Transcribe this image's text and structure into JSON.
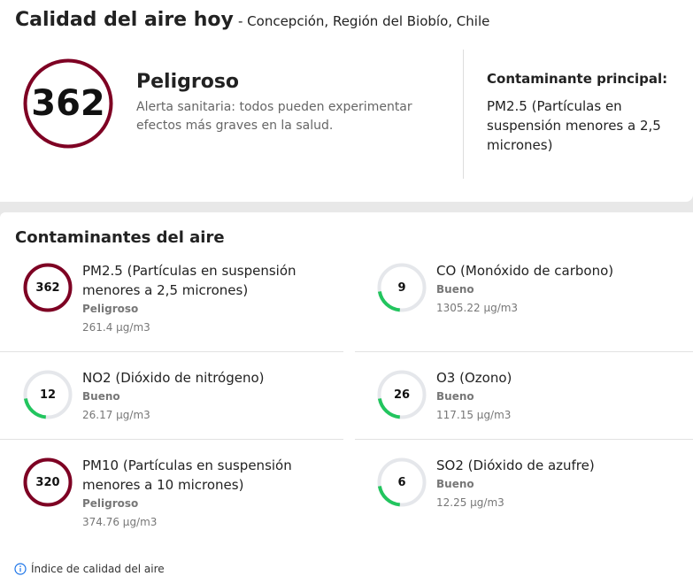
{
  "header": {
    "title": "Calidad del aire hoy",
    "location": "- Concepción, Región del Biobío, Chile"
  },
  "summary": {
    "aqi": "362",
    "level": "Peligroso",
    "description": "Alerta sanitaria: todos pueden experimentar efectos más graves en la salud.",
    "main_pollutant_label": "Contaminante principal:",
    "main_pollutant_value": "PM2.5 (Partículas en suspensión menores a 2,5 micrones)"
  },
  "pollutants_section": {
    "title": "Contaminantes del aire",
    "items": [
      {
        "name": "PM2.5 (Partículas en suspensión menores a 2,5 micrones)",
        "value": "362",
        "level": "Peligroso",
        "concentration": "261.4 µg/m3",
        "color": "#7e0023",
        "fill": 1.0
      },
      {
        "name": "CO (Monóxido de carbono)",
        "value": "9",
        "level": "Bueno",
        "concentration": "1305.22 µg/m3",
        "color": "#22c55e",
        "fill": 0.18
      },
      {
        "name": "NO2 (Dióxido de nitrógeno)",
        "value": "12",
        "level": "Bueno",
        "concentration": "26.17 µg/m3",
        "color": "#22c55e",
        "fill": 0.18
      },
      {
        "name": "O3 (Ozono)",
        "value": "26",
        "level": "Bueno",
        "concentration": "117.15 µg/m3",
        "color": "#22c55e",
        "fill": 0.2
      },
      {
        "name": "PM10 (Partículas en suspensión menores a 10 micrones)",
        "value": "320",
        "level": "Peligroso",
        "concentration": "374.76 µg/m3",
        "color": "#7e0023",
        "fill": 1.0
      },
      {
        "name": "SO2 (Dióxido de azufre)",
        "value": "6",
        "level": "Bueno",
        "concentration": "12.25 µg/m3",
        "color": "#22c55e",
        "fill": 0.18
      }
    ]
  },
  "footer": {
    "link_label": "Índice de calidad del aire",
    "icon": "info-icon"
  },
  "colors": {
    "hazardous": "#7e0023",
    "good": "#22c55e",
    "track": "#e5e7eb"
  }
}
